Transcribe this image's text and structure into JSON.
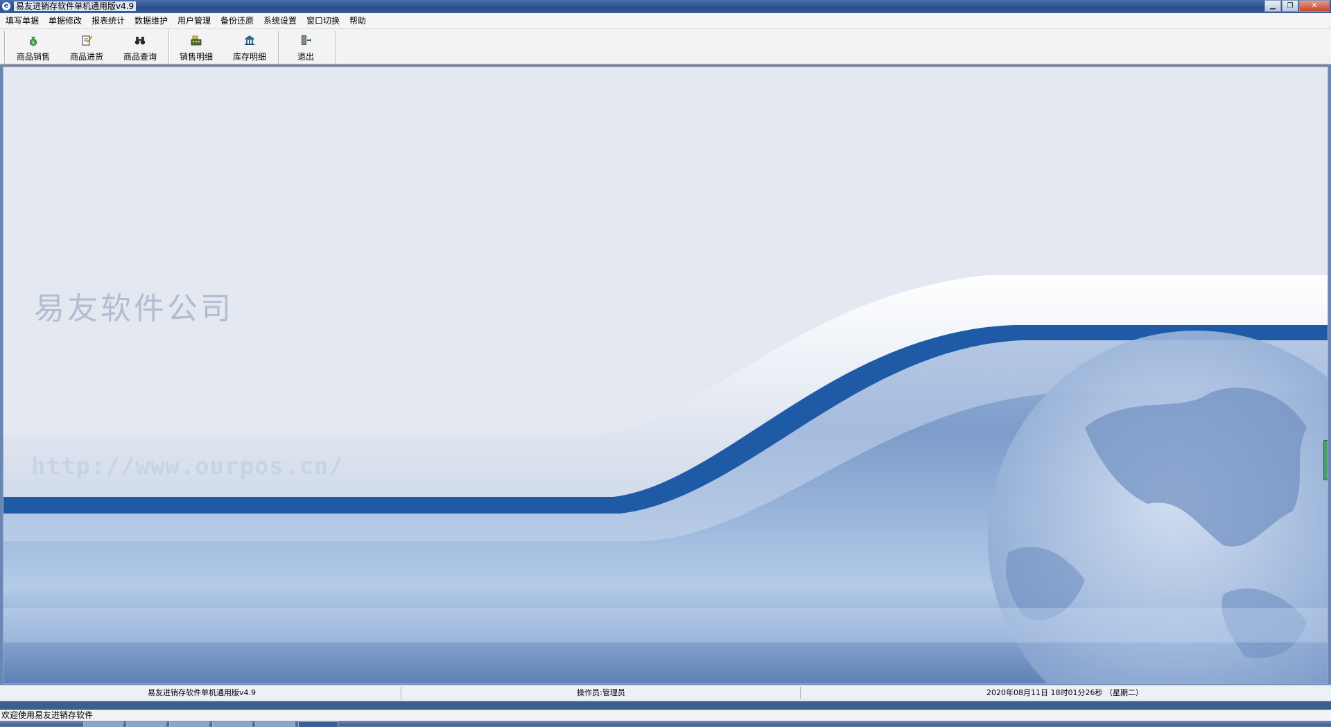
{
  "window": {
    "title": "易友进销存软件单机通用版v4.9",
    "controls": [
      "minimize",
      "restore",
      "close"
    ]
  },
  "menu": {
    "items": [
      "填写单据",
      "单据修改",
      "报表统计",
      "数据维护",
      "用户管理",
      "备份还原",
      "系统设置",
      "窗口切换",
      "帮助"
    ]
  },
  "toolbar": {
    "buttons": [
      {
        "label": "商品销售",
        "icon": "money-bag-icon"
      },
      {
        "label": "商品进货",
        "icon": "edit-document-icon"
      },
      {
        "label": "商品查询",
        "icon": "binoculars-icon"
      },
      {
        "label": "销售明细",
        "icon": "cash-register-icon"
      },
      {
        "label": "库存明细",
        "icon": "bank-icon"
      },
      {
        "label": "退出",
        "icon": "exit-door-icon"
      }
    ]
  },
  "background": {
    "company": "易友软件公司",
    "url": "http://www.ourpos.cn/"
  },
  "status": {
    "product": "易友进销存软件单机通用版v4.9",
    "operator": "操作员:管理员",
    "datetime": "2020年08月11日 18时01分26秒 （星期二）"
  },
  "footer": {
    "welcome": "欢迎使用易友进销存软件"
  },
  "colors": {
    "accent_blue": "#1f5aa6",
    "background": "#e4e8f1"
  }
}
